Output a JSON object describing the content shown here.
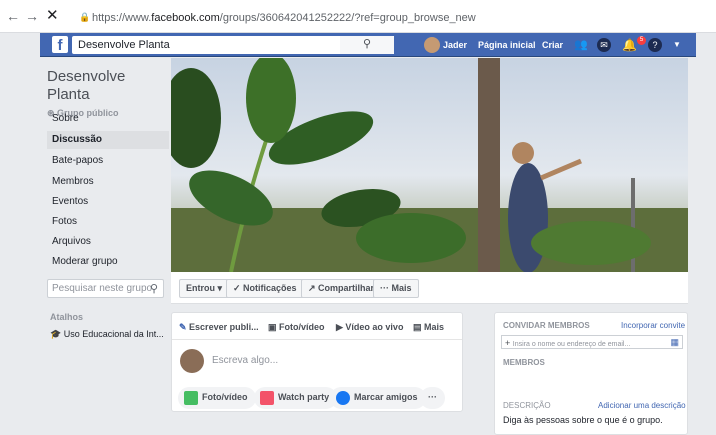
{
  "browser": {
    "url_scheme": "https://www.",
    "url_host": "facebook.com",
    "url_path": "/groups/360642041252222/?ref=group_browse_new"
  },
  "fb_header": {
    "logo": "f",
    "search_value": "Desenvolve Planta",
    "user_name": "Jader",
    "home_label": "Página inicial",
    "create_label": "Criar",
    "notif_count": "5"
  },
  "group": {
    "name": "Desenvolve Planta",
    "privacy": "Grupo público",
    "nav": [
      "Sobre",
      "Discussão",
      "Bate-papos",
      "Membros",
      "Eventos",
      "Fotos",
      "Arquivos",
      "Moderar grupo"
    ],
    "search_placeholder": "Pesquisar neste grupo",
    "shortcuts_heading": "Atalhos",
    "shortcut_item": "Uso Educacional da Int..."
  },
  "actions": {
    "joined": "Entrou ▾",
    "notifications": "✓ Notificações",
    "share": "↗ Compartilhar",
    "more": "··· Mais"
  },
  "composer": {
    "tab_write": "Escrever publi...",
    "tab_photo": "Foto/vídeo",
    "tab_live": "Vídeo ao vivo",
    "tab_more": "Mais",
    "placeholder": "Escreva algo...",
    "btn_photo": "Foto/vídeo",
    "btn_watch": "Watch party",
    "btn_tag": "Marcar amigos",
    "btn_more": "···"
  },
  "right": {
    "invite_heading": "CONVIDAR MEMBROS",
    "invite_link": "Incorporar convite",
    "invite_placeholder": "Insira o nome ou endereço de email...",
    "members_heading": "MEMBROS",
    "desc_heading": "DESCRIÇÃO",
    "desc_link": "Adicionar uma descrição",
    "desc_text": "Diga às pessoas sobre o que é o grupo."
  }
}
